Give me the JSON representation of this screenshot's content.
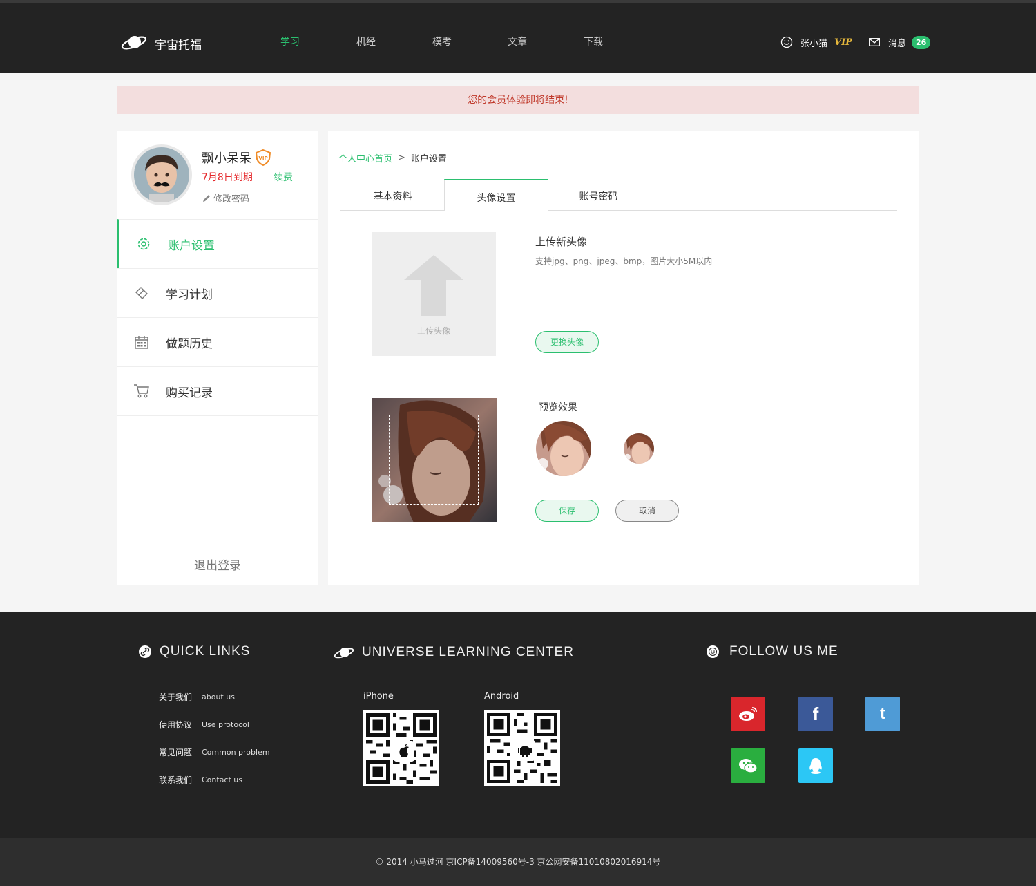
{
  "header": {
    "brand": "宇宙托福",
    "nav": [
      "学习",
      "机经",
      "模考",
      "文章",
      "下载"
    ],
    "active_nav": "学习",
    "username": "张小猫",
    "vip_label": "VIP",
    "messages_label": "消息",
    "messages_count": "26"
  },
  "notice": "您的会员体验即将结束!",
  "profile": {
    "name": "飘小呆呆",
    "expire": "7月8日到期",
    "renew": "续费",
    "change_password": "修改密码"
  },
  "sidebar": {
    "items": [
      {
        "label": "账户设置",
        "icon": "gear-icon",
        "active": true
      },
      {
        "label": "学习计划",
        "icon": "pencil-ruler-icon",
        "active": false
      },
      {
        "label": "做题历史",
        "icon": "calendar-icon",
        "active": false
      },
      {
        "label": "购买记录",
        "icon": "cart-icon",
        "active": false
      }
    ],
    "logout": "退出登录"
  },
  "breadcrumb": {
    "home": "个人中心首页",
    "sep": ">",
    "current": "账户设置"
  },
  "tabs": [
    "基本资料",
    "头像设置",
    "账号密码"
  ],
  "active_tab": "头像设置",
  "upload": {
    "box_label": "上传头像",
    "title": "上传新头像",
    "desc": "支持jpg、png、jpeg、bmp，图片大小5M以内",
    "change_button": "更换头像"
  },
  "preview": {
    "title": "预览效果",
    "save": "保存",
    "cancel": "取消"
  },
  "footer": {
    "quick_links_title": "QUICK  LINKS",
    "center_title": "UNIVERSE  LEARNING  CENTER",
    "follow_title": "FOLLOW  US  ME",
    "links": [
      {
        "cn": "关于我们",
        "en": "about us"
      },
      {
        "cn": "使用协议",
        "en": "Use protocol"
      },
      {
        "cn": "常见问题",
        "en": "Common problem"
      },
      {
        "cn": "联系我们",
        "en": "Contact us"
      }
    ],
    "iphone": "iPhone",
    "android": "Android",
    "social_colors": {
      "weibo": "#d9262c",
      "facebook": "#3b5998",
      "tumblr": "#4f9bd6",
      "wechat": "#2aae3f",
      "qq": "#2cc7f5"
    },
    "copyright": "© 2014 小马过河 京ICP备14009560号-3 京公网安备11010802016914号"
  },
  "colors": {
    "accent": "#2bbf6f",
    "header_bg": "#232323",
    "notice_bg": "#f3dede",
    "notice_text": "#c0392b"
  }
}
